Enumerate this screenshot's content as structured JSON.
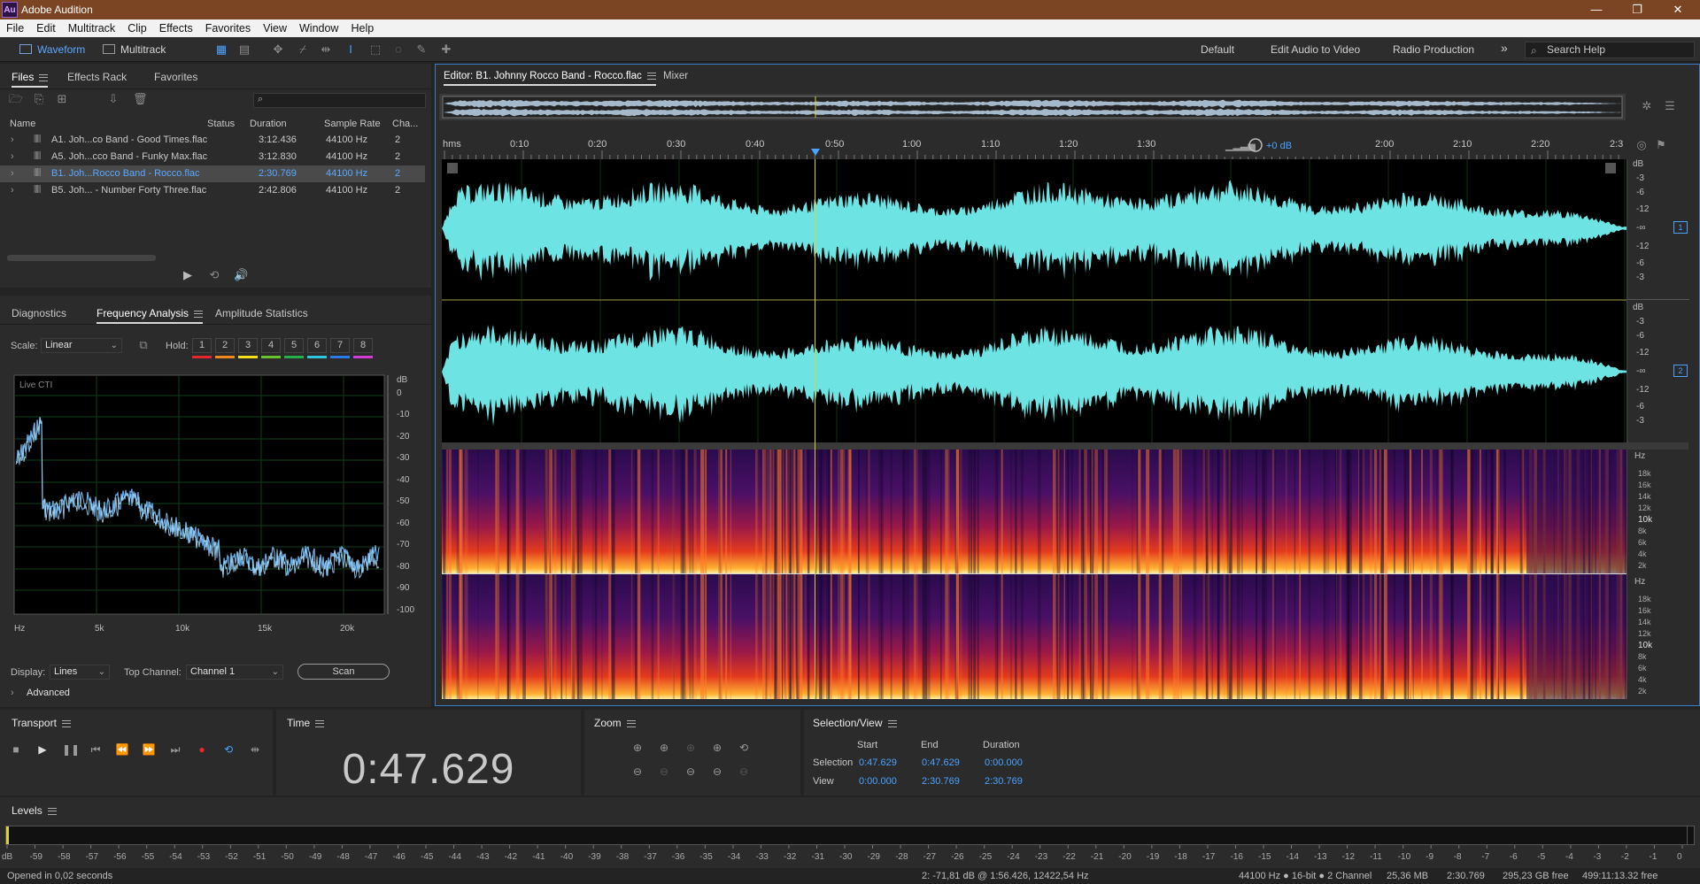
{
  "app": {
    "title": "Adobe Audition",
    "logo": "Au"
  },
  "window_controls": {
    "minimize": "—",
    "restore": "❐",
    "close": "✕"
  },
  "menu": [
    "File",
    "Edit",
    "Multitrack",
    "Clip",
    "Effects",
    "Favorites",
    "View",
    "Window",
    "Help"
  ],
  "toolbar": {
    "waveform_label": "Waveform",
    "multitrack_label": "Multitrack",
    "workspaces": [
      "Default",
      "Edit Audio to Video",
      "Radio Production"
    ],
    "more": "»",
    "search_placeholder": "Search Help"
  },
  "files_panel": {
    "tabs": [
      "Files",
      "Effects Rack",
      "Favorites"
    ],
    "columns": [
      "Name",
      "Status",
      "Duration",
      "Sample Rate",
      "Cha..."
    ],
    "rows": [
      {
        "name": "A1. Joh...co Band - Good Times.flac",
        "duration": "3:12.436",
        "rate": "44100 Hz",
        "channels": "2"
      },
      {
        "name": "A5. Joh...cco Band - Funky Max.flac",
        "duration": "3:12.830",
        "rate": "44100 Hz",
        "channels": "2"
      },
      {
        "name": "B1. Joh...Rocco Band - Rocco.flac",
        "duration": "2:30.769",
        "rate": "44100 Hz",
        "channels": "2"
      },
      {
        "name": "B5. Joh... - Number Forty Three.flac",
        "duration": "2:42.806",
        "rate": "44100 Hz",
        "channels": "2"
      }
    ],
    "selected_index": 2
  },
  "analysis_panel": {
    "tabs": [
      "Diagnostics",
      "Frequency Analysis",
      "Amplitude Statistics"
    ],
    "scale_label": "Scale:",
    "scale_value": "Linear",
    "hold_label": "Hold:",
    "hold_buttons": [
      "1",
      "2",
      "3",
      "4",
      "5",
      "6",
      "7",
      "8"
    ],
    "hold_colors": [
      "#e8262b",
      "#f08a1a",
      "#f2e11a",
      "#66c52c",
      "#23b04a",
      "#2bc8e0",
      "#2a7bea",
      "#d43ad4"
    ],
    "graph_title": "Live CTI",
    "db_label": "dB",
    "db_ticks": [
      "0",
      "-10",
      "-20",
      "-30",
      "-40",
      "-50",
      "-60",
      "-70",
      "-80",
      "-90",
      "-100"
    ],
    "freq_ticks": [
      "Hz",
      "5k",
      "10k",
      "15k",
      "20k"
    ],
    "display_label": "Display:",
    "display_value": "Lines",
    "top_channel_label": "Top Channel:",
    "top_channel_value": "Channel 1",
    "scan_button": "Scan",
    "advanced_label": "Advanced"
  },
  "editor": {
    "tab_title": "Editor: B1. Johnny Rocco Band - Rocco.flac",
    "mixer_tab": "Mixer",
    "time_ticks": [
      "hms",
      "0:10",
      "0:20",
      "0:30",
      "0:40",
      "0:50",
      "1:00",
      "1:10",
      "1:20",
      "1:30",
      "2:00",
      "2:10",
      "2:20",
      "2:3"
    ],
    "gain_label": "+0 dB",
    "db_scale_ch": [
      "dB",
      "-3",
      "-6",
      "-12",
      "-∞",
      "-12",
      "-6",
      "-3"
    ],
    "channel_badges": [
      "1",
      "2"
    ],
    "hz_scale": [
      "Hz",
      "18k",
      "16k",
      "14k",
      "12k",
      "10k",
      "8k",
      "6k",
      "4k",
      "2k"
    ]
  },
  "transport": {
    "title": "Transport",
    "icons": [
      "stop-icon",
      "play-icon",
      "pause-icon",
      "go-to-start-icon",
      "rewind-icon",
      "fast-forward-icon",
      "go-to-end-icon",
      "record-icon",
      "loop-icon",
      "skip-icon"
    ]
  },
  "time_panel": {
    "title": "Time",
    "value": "0:47.629"
  },
  "zoom_panel": {
    "title": "Zoom"
  },
  "selection_view": {
    "title": "Selection/View",
    "headers": [
      "Start",
      "End",
      "Duration"
    ],
    "selection": {
      "label": "Selection",
      "start": "0:47.629",
      "end": "0:47.629",
      "duration": "0:00.000"
    },
    "view": {
      "label": "View",
      "start": "0:00.000",
      "end": "2:30.769",
      "duration": "2:30.769"
    }
  },
  "levels": {
    "title": "Levels",
    "ticks": [
      "dB",
      "-59",
      "-58",
      "-57",
      "-56",
      "-55",
      "-54",
      "-53",
      "-52",
      "-51",
      "-50",
      "-49",
      "-48",
      "-47",
      "-46",
      "-45",
      "-44",
      "-43",
      "-42",
      "-41",
      "-40",
      "-39",
      "-38",
      "-37",
      "-36",
      "-35",
      "-34",
      "-33",
      "-32",
      "-31",
      "-30",
      "-29",
      "-28",
      "-27",
      "-26",
      "-25",
      "-24",
      "-23",
      "-22",
      "-21",
      "-20",
      "-19",
      "-18",
      "-17",
      "-16",
      "-15",
      "-14",
      "-13",
      "-12",
      "-11",
      "-10",
      "-9",
      "-8",
      "-7",
      "-6",
      "-5",
      "-4",
      "-3",
      "-2",
      "-1",
      "0"
    ]
  },
  "status": {
    "left": "Opened in 0,02 seconds",
    "cursor_info": "2: -71,81 dB @ 1:56.426, 12422,54 Hz",
    "format": "44100 Hz ● 16-bit ● 2 Channel",
    "size": "25,36 MB",
    "duration": "2:30.769",
    "free": "295,23 GB free",
    "free_time": "499:11:13.32 free"
  },
  "colors": {
    "accent": "#3b7ec7",
    "waveform": "#6ee3e3",
    "selection_text": "#4aa3ff",
    "playhead": "#d8d23a"
  }
}
